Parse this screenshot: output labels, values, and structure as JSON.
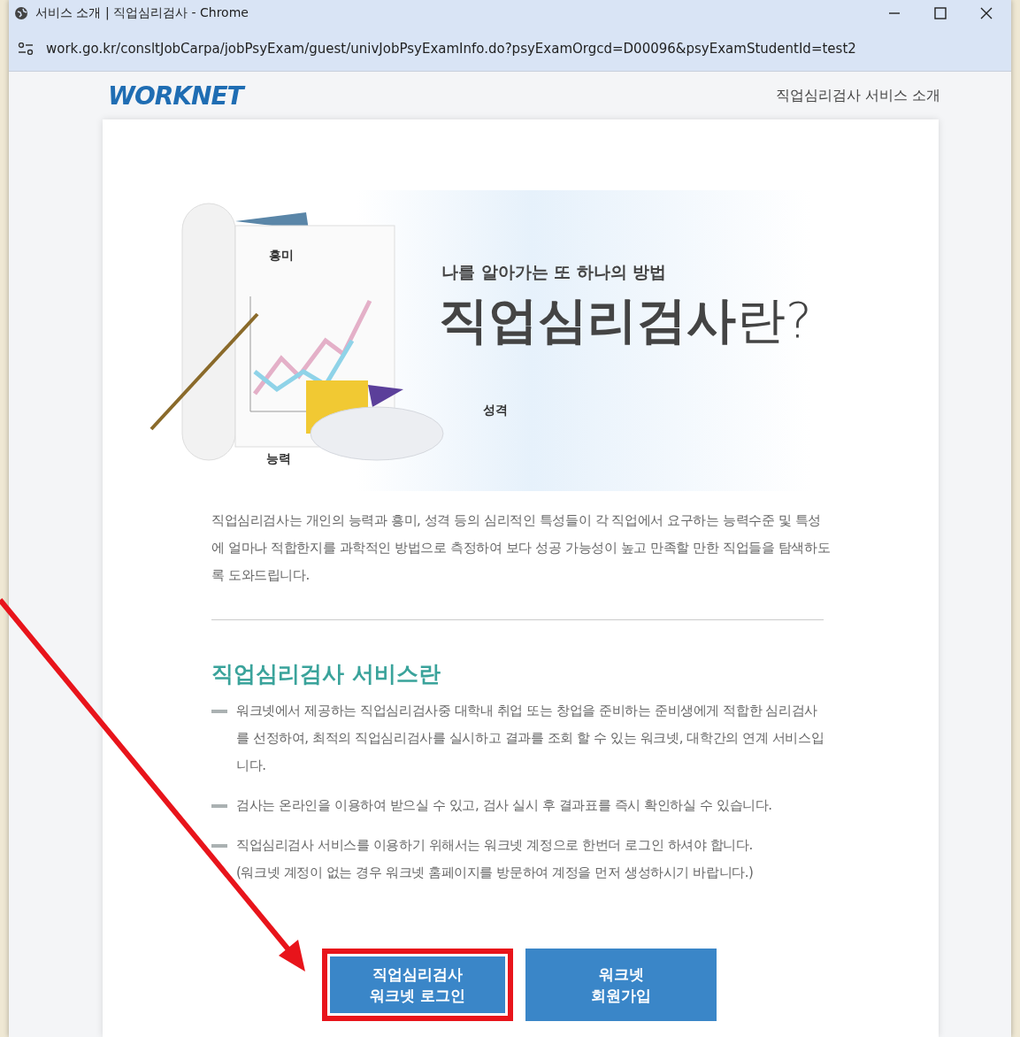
{
  "window": {
    "title": "서비스 소개 | 직업심리검사 - Chrome",
    "url": "work.go.kr/consltJobCarpa/jobPsyExam/guest/univJobPsyExamInfo.do?psyExamOrgcd=D00096&psyExamStudentId=test2"
  },
  "header": {
    "logo": "WORKNET",
    "nav_link": "직업심리검사 서비스 소개"
  },
  "hero": {
    "labels": [
      "흥미",
      "성격",
      "능력"
    ],
    "subtitle": "나를 알아가는 또 하나의 방법",
    "title": "**직업심리검사**란?"
  },
  "intro": "직업심리검사는 개인의 능력과 흥미, 성격 등의 심리적인 특성들이 각 직업에서 요구하는 능력수준 및 특성에 얼마나 적합한지를 과학적인 방법으로 측정하여 보다 성공 가능성이 높고 만족할 만한 직업들을 탐색하도록 도와드립니다.",
  "section": {
    "heading": "직업심리검사 서비스란",
    "items": [
      {
        "text": "워크넷에서 제공하는 직업심리검사중 대학내 취업 또는 창업을 준비하는 준비생에게 적합한 심리검사를 선정하여, 최적의 직업심리검사를 실시하고 결과를 조회 할 수 있는 워크넷, 대학간의 연계 서비스입니다."
      },
      {
        "text": "검사는 온라인을 이용하여 받으실 수 있고, 검사 실시 후 결과표를 즉시 확인하실 수 있습니다."
      },
      {
        "text": "직업심리검사 서비스를 이용하기 위해서는 워크넷 계정으로 한번더 로그인 하셔야 합니다.",
        "note": "(워크넷 계정이 없는 경우 워크넷 홈페이지를 방문하여 계정을 먼저 생성하시기 바랍니다.)"
      }
    ]
  },
  "buttons": [
    {
      "label": "직업심리검사\n워크넷 로그인",
      "highlighted": true
    },
    {
      "label": "워크넷\n회원가입",
      "highlighted": false
    }
  ]
}
